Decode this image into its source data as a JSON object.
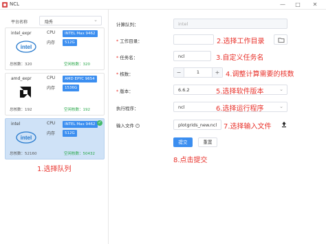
{
  "window": {
    "title": "NCL",
    "minimize": "—",
    "maximize": "□",
    "close": "✕"
  },
  "left": {
    "platform_label": "平台名称",
    "platform_value": "隐秀",
    "cards": [
      {
        "name": "intel_expr",
        "logo": "intel-logo",
        "cpu_label": "CPU",
        "cpu": "INTEL Max 9462",
        "mem_label": "内存",
        "mem": "512G",
        "total": "总核数：320",
        "free": "空闲核数：320",
        "selected": false
      },
      {
        "name": "amd_expr",
        "logo": "amd-logo",
        "cpu_label": "CPU",
        "cpu": "AMD EPYC 9654",
        "mem_label": "内存",
        "mem": "1536G",
        "total": "总核数：192",
        "free": "空闲核数：192",
        "selected": false
      },
      {
        "name": "intel",
        "logo": "intel-logo",
        "cpu_label": "CPU",
        "cpu": "INTEL Max 9462",
        "mem_label": "内存",
        "mem": "512G",
        "total": "总核数：52160",
        "free": "空闲核数：50432",
        "selected": true
      }
    ]
  },
  "form": {
    "queue_label": "计算队列：",
    "queue_value": "intel",
    "workdir_label": "工作目录：",
    "workdir_value": "",
    "jobname_label": "任务名：",
    "jobname_value": "ncl",
    "cores_label": "核数：",
    "cores_value": "1",
    "version_label": "版本：",
    "version_value": "6.6.2",
    "program_label": "执行程序：",
    "program_value": "ncl",
    "input_label": "输入文件",
    "input_value": "plotgrids_new.ncl",
    "submit": "提交",
    "reset": "重置",
    "required_mark": "*",
    "help_mark": "?",
    "stepper_minus": "−",
    "stepper_plus": "+",
    "chevron": "⌄"
  },
  "annotations": {
    "a1": "1.选择队列",
    "a2": "2.选择工作目录",
    "a3": "3.自定义任务名",
    "a4": "4.调整计算需要的核数",
    "a5": "5.选择软件版本",
    "a6": "6.选择运行程序",
    "a7": "7.选择输入文件",
    "a8": "8.点击提交"
  },
  "colors": {
    "accent": "#3b8ef0",
    "selected_bg": "#cfe2f7",
    "annotation": "#e8322b",
    "free_green": "#2aa84a"
  }
}
